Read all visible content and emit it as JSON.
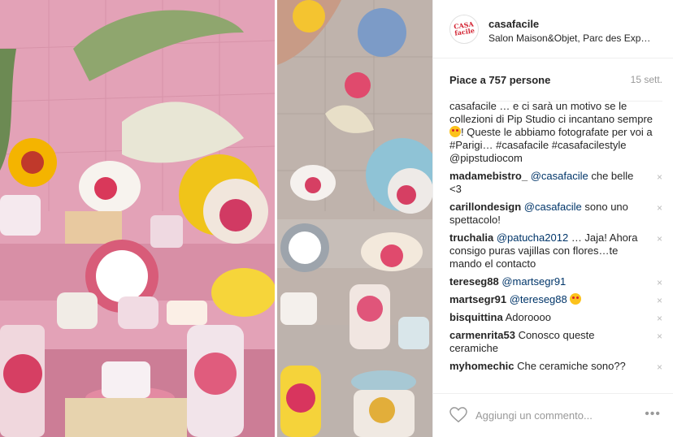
{
  "post": {
    "username": "casafacile",
    "location": "Salon Maison&Objet, Parc des Exp…",
    "avatar_text": "CASA facile",
    "likes": "Piace a 757 persone",
    "time": "15 sett.",
    "caption": {
      "user": "casafacile",
      "text1": " … e ci sarà un motivo se le collezioni di Pip Studio ci incantano sempre ",
      "text2": "! Queste le abbiamo fotografate per voi a ",
      "hashtag_parigi": "#Parigi",
      "text3": "… ",
      "hashtags": "#casafacile #casafacilestyle",
      "mention": "@pipstudiocom"
    },
    "comments": [
      {
        "user": "madamebistro_",
        "mention": "@casafacile",
        "text": " che belle <3"
      },
      {
        "user": "carillondesign",
        "mention": "@casafacile",
        "text": " sono uno spettacolo!"
      },
      {
        "user": "truchalia",
        "mention": "@patucha2012",
        "text": " … Jaja! Ahora consigo puras vajillas con flores…te mando el contacto"
      },
      {
        "user": "tereseg88",
        "mention": "@martsegr91",
        "text": ""
      },
      {
        "user": "martsegr91",
        "mention": "@tereseg88",
        "text": ""
      },
      {
        "user": "bisquittina",
        "mention": "",
        "text": " Adoroooo"
      },
      {
        "user": "carmenrita53",
        "mention": "",
        "text": " Conosco queste ceramiche"
      },
      {
        "user": "myhomechic",
        "mention": "",
        "text": " Che ceramiche sono??"
      }
    ],
    "delete_glyph": "×",
    "add_comment_placeholder": "Aggiungi un commento...",
    "more_glyph": "•••",
    "icons": {
      "heart": "heart-outline-icon",
      "more": "more-options-icon",
      "delete": "close-icon"
    },
    "colors": {
      "link": "#003569",
      "muted": "#999999",
      "brand_red": "#d32231"
    }
  }
}
